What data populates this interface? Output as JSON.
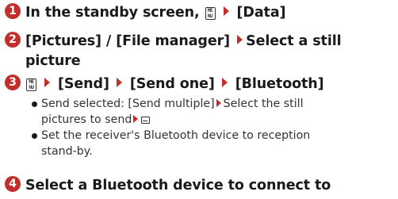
{
  "steps": [
    {
      "number": "1",
      "parts": [
        "In the standby screen,",
        "[Data]"
      ]
    },
    {
      "number": "2",
      "line1": "[Pictures] / [File manager]",
      "line1b": "Select a still",
      "line2": "picture"
    },
    {
      "number": "3",
      "parts": [
        "[Send]",
        "[Send one]",
        "[Bluetooth]"
      ],
      "bullets": [
        {
          "a": "Send selected: [Send multiple]",
          "b": "Select the still",
          "c": "pictures to send"
        },
        {
          "a": "Set the receiver's Bluetooth device to reception",
          "b": "stand-by."
        }
      ]
    },
    {
      "number": "4",
      "text": "Select a Bluetooth device to connect to"
    }
  ],
  "icons": {
    "menu_key": "menu-key-icon",
    "arrow": "red-triangle-arrow-icon",
    "mail_key": "mail-key-icon"
  },
  "menu_key_label": "ME\nNU",
  "colors": {
    "accent": "#c22e2a",
    "text": "#1a1a1a"
  }
}
